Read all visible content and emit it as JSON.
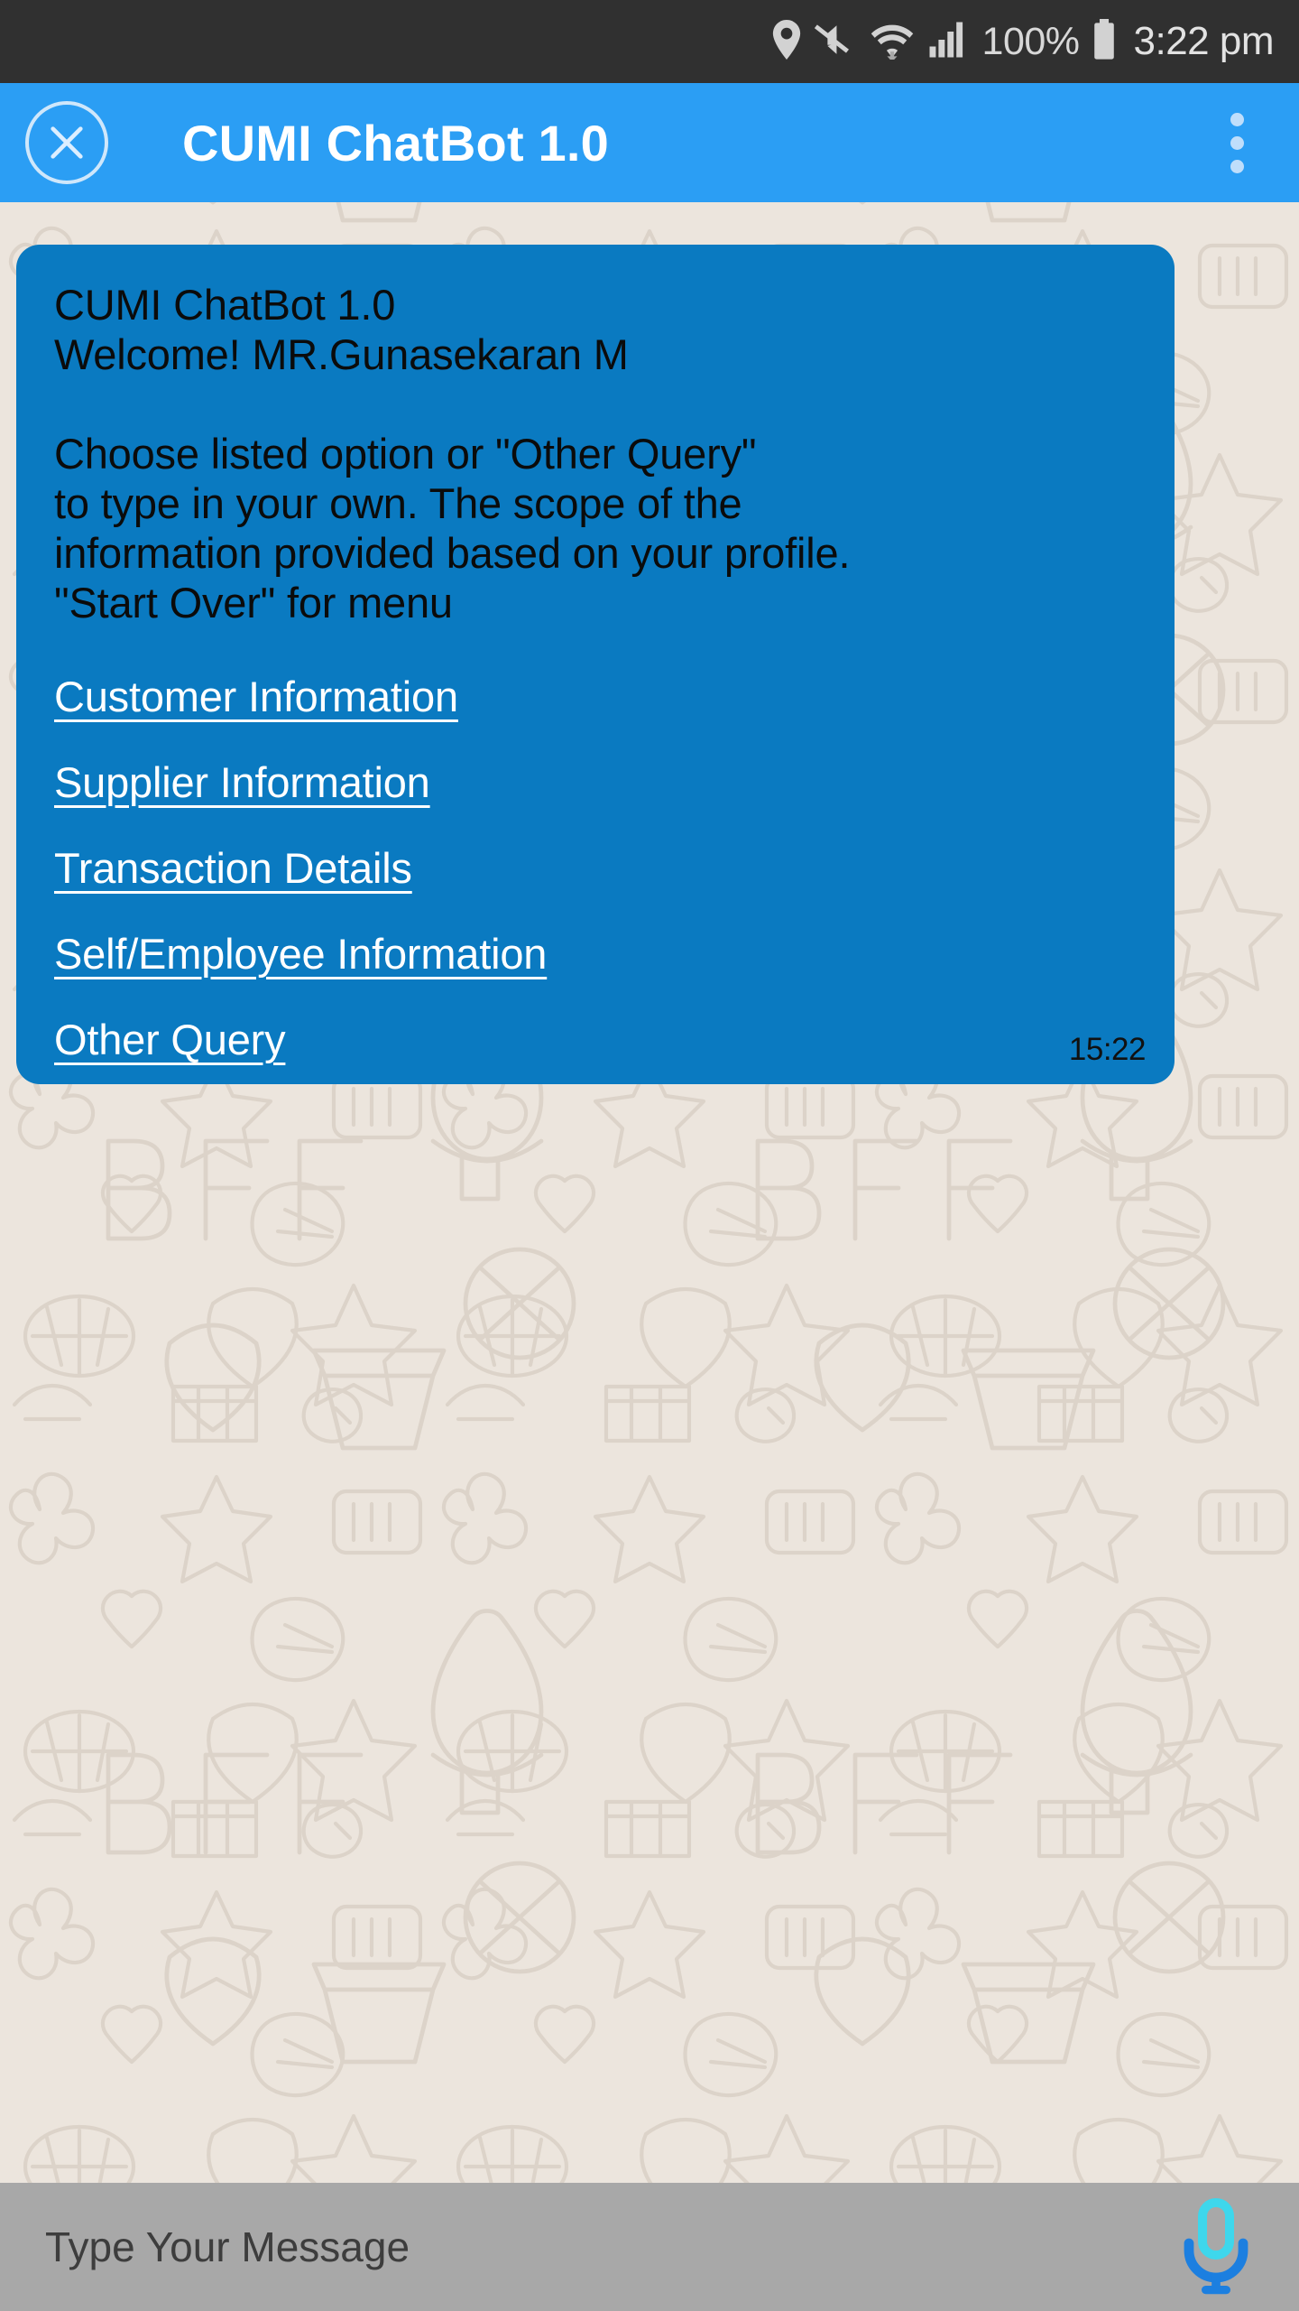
{
  "status_bar": {
    "icons": [
      "location-icon",
      "mute-icon",
      "wifi-icon",
      "signal-icon",
      "battery-icon"
    ],
    "battery_percent": "100%",
    "time": "3:22 pm",
    "background_color": "#303030"
  },
  "app_bar": {
    "close_label": "×",
    "title": "CUMI ChatBot 1.0",
    "overflow_label": "more-options",
    "background_color": "#2b9ef4"
  },
  "chat": {
    "background_color": "#ece5dd",
    "bubble": {
      "background_color": "#0a7ac1",
      "body": "CUMI ChatBot 1.0\nWelcome! MR.Gunasekaran M\n\nChoose listed option or \"Other Query\"\nto type in your own. The scope of the\ninformation provided based on your profile.\n\"Start Over\" for menu",
      "options": [
        "Customer Information",
        "Supplier Information",
        "Transaction Details",
        "Self/Employee Information",
        "Other Query"
      ],
      "timestamp": "15:22"
    }
  },
  "input_bar": {
    "placeholder": "Type Your Message",
    "value": "",
    "mic_label": "microphone",
    "background_color": "#a8a8a8",
    "mic_color_top": "#3ed7ec",
    "mic_color_base": "#1c7fe0"
  }
}
